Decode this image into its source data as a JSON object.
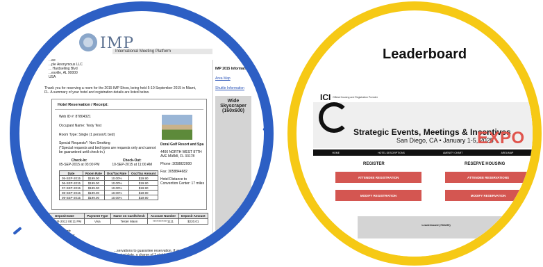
{
  "left": {
    "logo_text": "IMP",
    "logo_tag": "International Meeting Platform",
    "address": [
      "...ee",
      "...ple Anonymous LLC",
      "... Hardselling Blvd",
      "...esville, AL 90000",
      "USA"
    ],
    "intro": "Thank you for reserving a room for the 2015 IMP Show, being held 5-10 September 2015 in Miami, FL. A summary of your hotel and registration details are listed below.",
    "hotel_heading": "Hotel Reservation / Receipt:",
    "web_id": "Web ID #: 87804321",
    "occupant": "Occupant Name: Testy Test",
    "room_type": "Room Type: Single (1 person/1 bed)",
    "special_requests": "Special Requests*: Non Smoking",
    "special_note": "(*Special requests and bed types are requests only and cannot be guaranteed until check-in.)",
    "checkin_label": "Check-In:",
    "checkin_value": "05-SEP-2015 at 03:00 PM",
    "checkout_label": "Check-Out:",
    "checkout_value": "10-SEP-2015 at 11:00 AM",
    "discounted_rate": "Special Discounted Rate:",
    "hotel_name": "Doral Golf Resort and Spa",
    "hotel_address": "4400 NORTH WEST 87TH AVE MIAMI, FL 33178",
    "hotel_phone": "Phone: 3058822000",
    "hotel_fax": "Fax: 3058844682",
    "hotel_distance": "Hotel Distance to Convention Center: 17 miles",
    "rate_headers": [
      "Date",
      "Room Rate",
      "Occ/Tax Rate",
      "Occ/Tax Amount"
    ],
    "rate_rows": [
      [
        "05-SEP-2015",
        "$199.00",
        "10.00%",
        "$19.90"
      ],
      [
        "06-SEP-2015",
        "$199.00",
        "10.00%",
        "$19.90"
      ],
      [
        "07-SEP-2015",
        "$199.00",
        "10.00%",
        "$19.90"
      ],
      [
        "08-SEP-2015",
        "$199.00",
        "10.00%",
        "$19.90"
      ],
      [
        "09-SEP-2015",
        "$199.00",
        "10.00%",
        "$19.90"
      ]
    ],
    "deposit_headers": [
      "Deposit Date",
      "Payment Type",
      "Name on Card/Check",
      "Account Number",
      "Deposit Amount"
    ],
    "deposit_row": [
      "21-MAR-2012 08:11 PM",
      "Visa",
      "Tester Mann",
      "************1111",
      "$220.01"
    ],
    "lower_lines": [
      "...ch / Receipt:",
      "...t's room and tax",
      "...n Policy:",
      "...rational"
    ],
    "footer_note": "...servations to guarantee reservation. If you do not cancel yo... ...arrival date, a charge of 1 night's room and tax will...",
    "right_title": "IMP 2015 Information",
    "right_links": [
      "Area Map",
      "Shuttle Information"
    ],
    "skyscraper": "Wide Skyscraper (160x600)"
  },
  "right": {
    "title": "Leaderboard",
    "provider": "Official Housing and Registration Provider",
    "event_title": "Strategic Events, Meetings & Incentives",
    "event_sub": "San Diego, CA • January 1-5, 2025",
    "expo": "EXPO",
    "nav": [
      "HOME",
      "HOTEL DESCRIPTIONS",
      "AMENITY CHART",
      "AREA MAP"
    ],
    "register_heading": "REGISTER",
    "housing_heading": "RESERVE HOUSING",
    "buttons": {
      "attendee_registration": "ATTENDEE REGISTRATION",
      "modify_registration": "MODIFY REGISTRATION",
      "attendee_reservations": "ATTENDEE RESERVATIONS",
      "modify_reservation": "MODIFY RESERVATION"
    },
    "leaderboard_ad": "Leaderboard (728x90)"
  },
  "colors": {
    "blue_ring": "#2d5fc4",
    "yellow_ring": "#f6c915",
    "button_red": "#d45651",
    "expo_red": "#e0554e"
  }
}
